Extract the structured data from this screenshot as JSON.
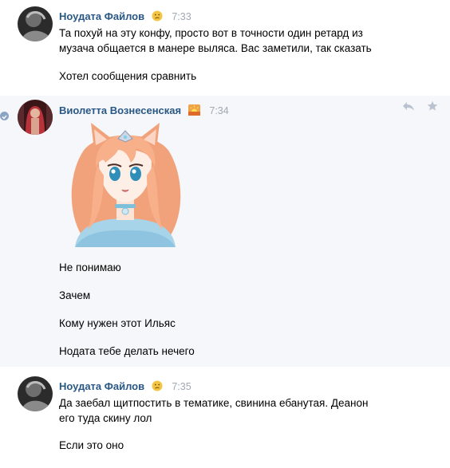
{
  "messages": [
    {
      "sender": "Ноудата Файлов",
      "emoji": "confused-face-emoji",
      "time": "7:33",
      "lines": [
        "Та похуй на эту конфу, просто вот в точности один ретард из",
        "музача общается в манере выляса. Вас заметили, так сказать"
      ],
      "extra": "Хотел сообщения сравнить"
    },
    {
      "sender": "Виолетта Вознесенская",
      "emoji": "sunrise-emoji",
      "time": "7:34",
      "sticker": "anime-fox-girl-sticker",
      "texts": [
        "Не понимаю",
        "Зачем",
        "Кому нужен этот Ильяс",
        "Нодата тебе делать нечего"
      ]
    },
    {
      "sender": "Ноудата Файлов",
      "emoji": "confused-face-emoji",
      "time": "7:35",
      "lines": [
        "Да заебал щитпостить в тематике, свинина ебанутая. Деанон",
        "его туда скину лол"
      ],
      "extra": "Если это оно"
    }
  ],
  "colors": {
    "name": "#2a5885",
    "time": "#a0a8b4",
    "highlight": "#f5f7fa"
  }
}
